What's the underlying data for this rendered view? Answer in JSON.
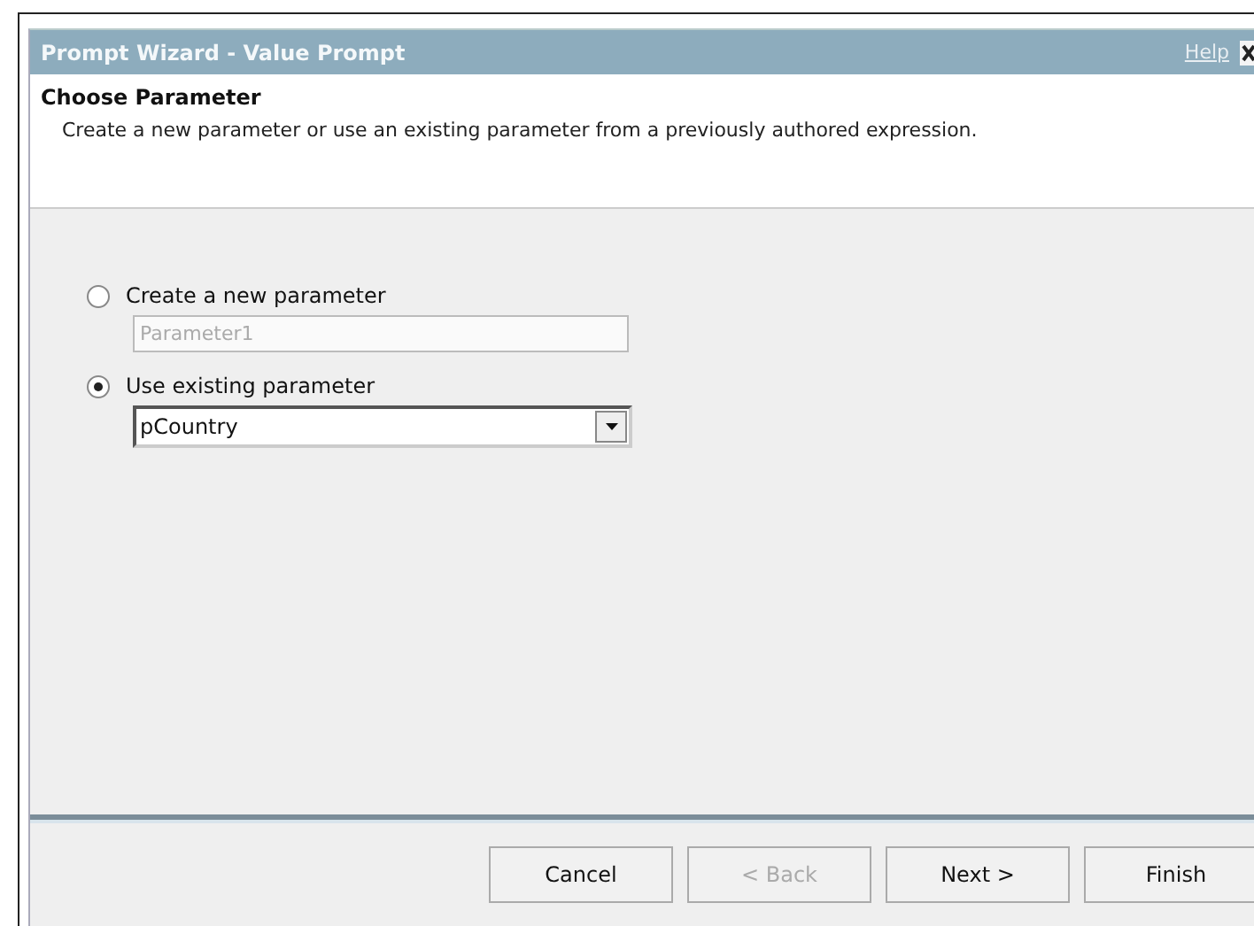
{
  "window": {
    "title": "Prompt Wizard - Value Prompt",
    "help": "Help"
  },
  "header": {
    "title": "Choose Parameter",
    "description": "Create a new parameter or use an existing parameter from a previously authored expression."
  },
  "options": [
    {
      "kind": "text",
      "label": "Create a new parameter",
      "selected": false,
      "placeholder": "Parameter1"
    },
    {
      "kind": "select",
      "label": "Use existing parameter",
      "selected": true,
      "value": "pCountry"
    }
  ],
  "buttons": [
    {
      "label": "Cancel",
      "disabled": false
    },
    {
      "label": "< Back",
      "disabled": true
    },
    {
      "label": "Next >",
      "disabled": false
    },
    {
      "label": "Finish",
      "disabled": false
    }
  ]
}
